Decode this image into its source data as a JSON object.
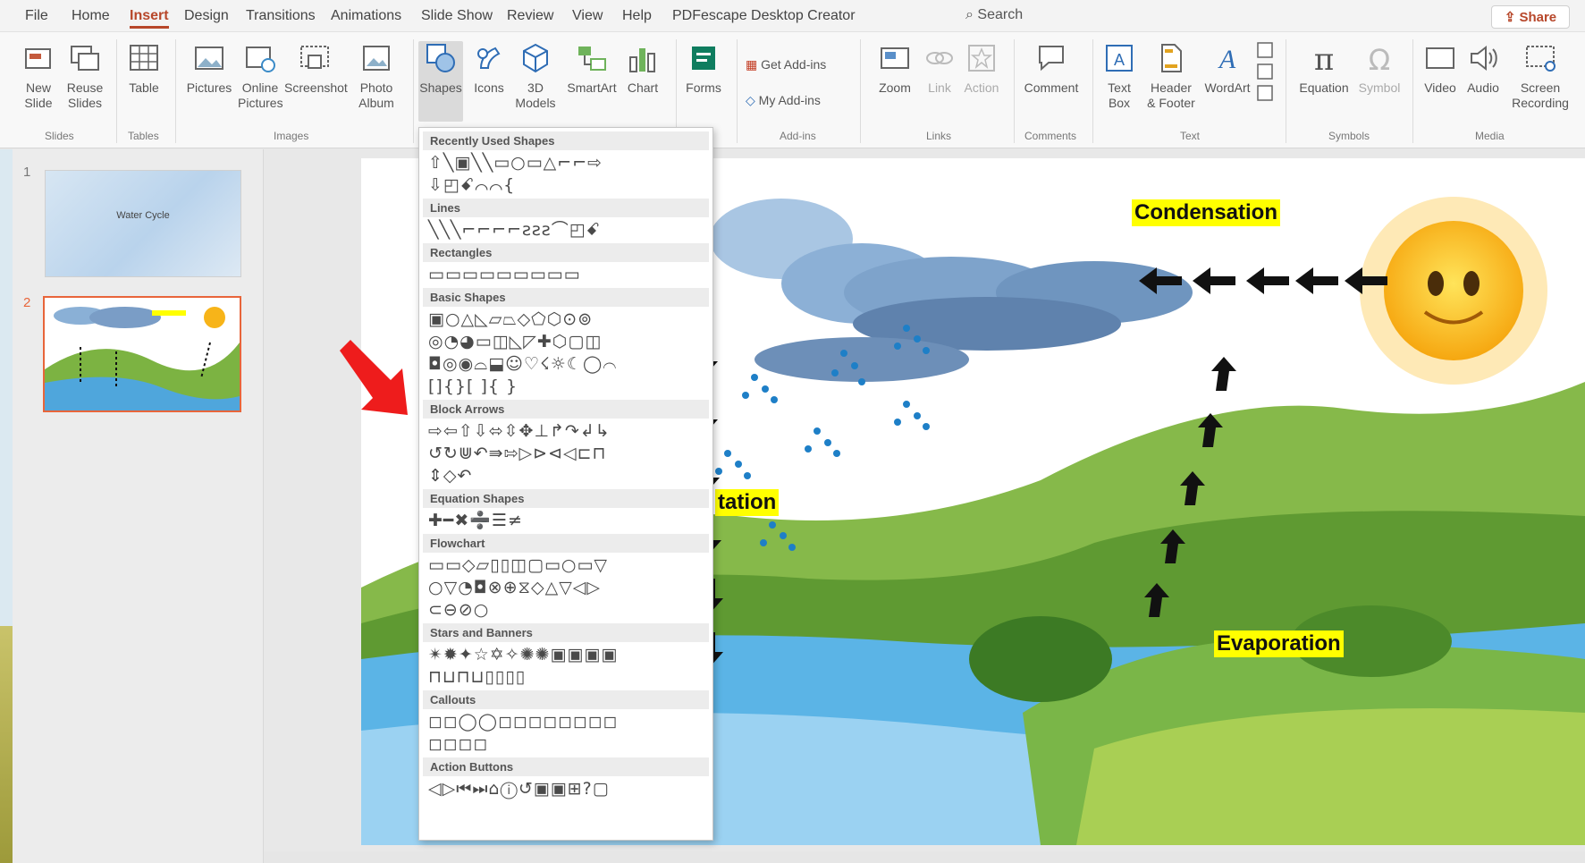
{
  "colors": {
    "accent": "#b7472a",
    "label_bg": "#ffff00",
    "selection_border": "#e8653a",
    "arrow_red": "#ee1c1c"
  },
  "tabs": [
    "File",
    "Home",
    "Insert",
    "Design",
    "Transitions",
    "Animations",
    "Slide Show",
    "Review",
    "View",
    "Help",
    "PDFescape Desktop Creator"
  ],
  "active_tab": "Insert",
  "search_label": "Search",
  "share_label": "Share",
  "ribbon": {
    "new_slide": "New\nSlide",
    "reuse_slides": "Reuse\nSlides",
    "table": "Table",
    "pictures": "Pictures",
    "online_pictures": "Online\nPictures",
    "screenshot": "Screenshot",
    "photo_album": "Photo\nAlbum",
    "shapes": "Shapes",
    "icons": "Icons",
    "models_3d": "3D\nModels",
    "smartart": "SmartArt",
    "chart": "Chart",
    "forms": "Forms",
    "get_addins": "Get Add-ins",
    "my_addins": "My Add-ins",
    "zoom": "Zoom",
    "link": "Link",
    "action": "Action",
    "comment": "Comment",
    "text_box": "Text\nBox",
    "header_footer": "Header\n& Footer",
    "wordart": "WordArt",
    "equation": "Equation",
    "symbol": "Symbol",
    "video": "Video",
    "audio": "Audio",
    "screen_recording": "Screen\nRecording",
    "groups": {
      "slides": "Slides",
      "tables": "Tables",
      "images": "Images",
      "addins": "Add-ins",
      "links": "Links",
      "comments": "Comments",
      "text": "Text",
      "symbols": "Symbols",
      "media": "Media"
    }
  },
  "slides": [
    {
      "num": "1",
      "title": "Water Cycle"
    },
    {
      "num": "2"
    }
  ],
  "slide_labels": {
    "condensation": "Condensation",
    "precipitation": "tation",
    "evaporation": "Evaporation"
  },
  "shapes_menu": {
    "sections": [
      {
        "name": "Recently Used Shapes",
        "rows": [
          "⇧╲▣╲╲▭○▭△⌐⌐⇨",
          "⇩◰ꗃ⌒⌒{"
        ]
      },
      {
        "name": "Lines",
        "rows": [
          "╲╲╲⌐⌐⌐⌐ƨƨƨ⌒◰ꗃ"
        ]
      },
      {
        "name": "Rectangles",
        "rows": [
          "▭▭▭▭▭▭▭▭▭"
        ]
      },
      {
        "name": "Basic Shapes",
        "rows": [
          "▣○△◺▱⏢◇⬠⬡⊙⊚",
          "◎◔◕▭◫◺◸✚⬡▢◫",
          "◘◎◉⌓⬓☺♡☇☼☾◯⌒",
          "[]{}[ ]{ }"
        ]
      },
      {
        "name": "Block Arrows",
        "rows": [
          "⇨⇦⇧⇩⬄⇳✥⊥↱↷↲↳",
          "↺↻⋓↶⇛⇰▷⊳⊲◁⊏⊓",
          "⇕◇↶"
        ]
      },
      {
        "name": "Equation Shapes",
        "rows": [
          "✚━✖➗☰≠"
        ]
      },
      {
        "name": "Flowchart",
        "rows": [
          "▭▭◇▱▯▯◫▢▭○▭▽",
          "○▽◔◘⊗⊕⧖◇△▽◁▷",
          "⊂⊖⊘○"
        ]
      },
      {
        "name": "Stars and Banners",
        "rows": [
          "✴✹✦☆✡✧✺✺▣▣▣▣",
          "⊓⊔⊓⊔▯▯▯▯"
        ]
      },
      {
        "name": "Callouts",
        "rows": [
          "◻◻◯◯◻◻◻◻◻◻◻◻",
          "◻◻◻◻"
        ]
      },
      {
        "name": "Action Buttons",
        "rows": [
          "◁▷⏮⏭⌂ⓘ↺▣▣⊞?▢"
        ]
      }
    ]
  }
}
